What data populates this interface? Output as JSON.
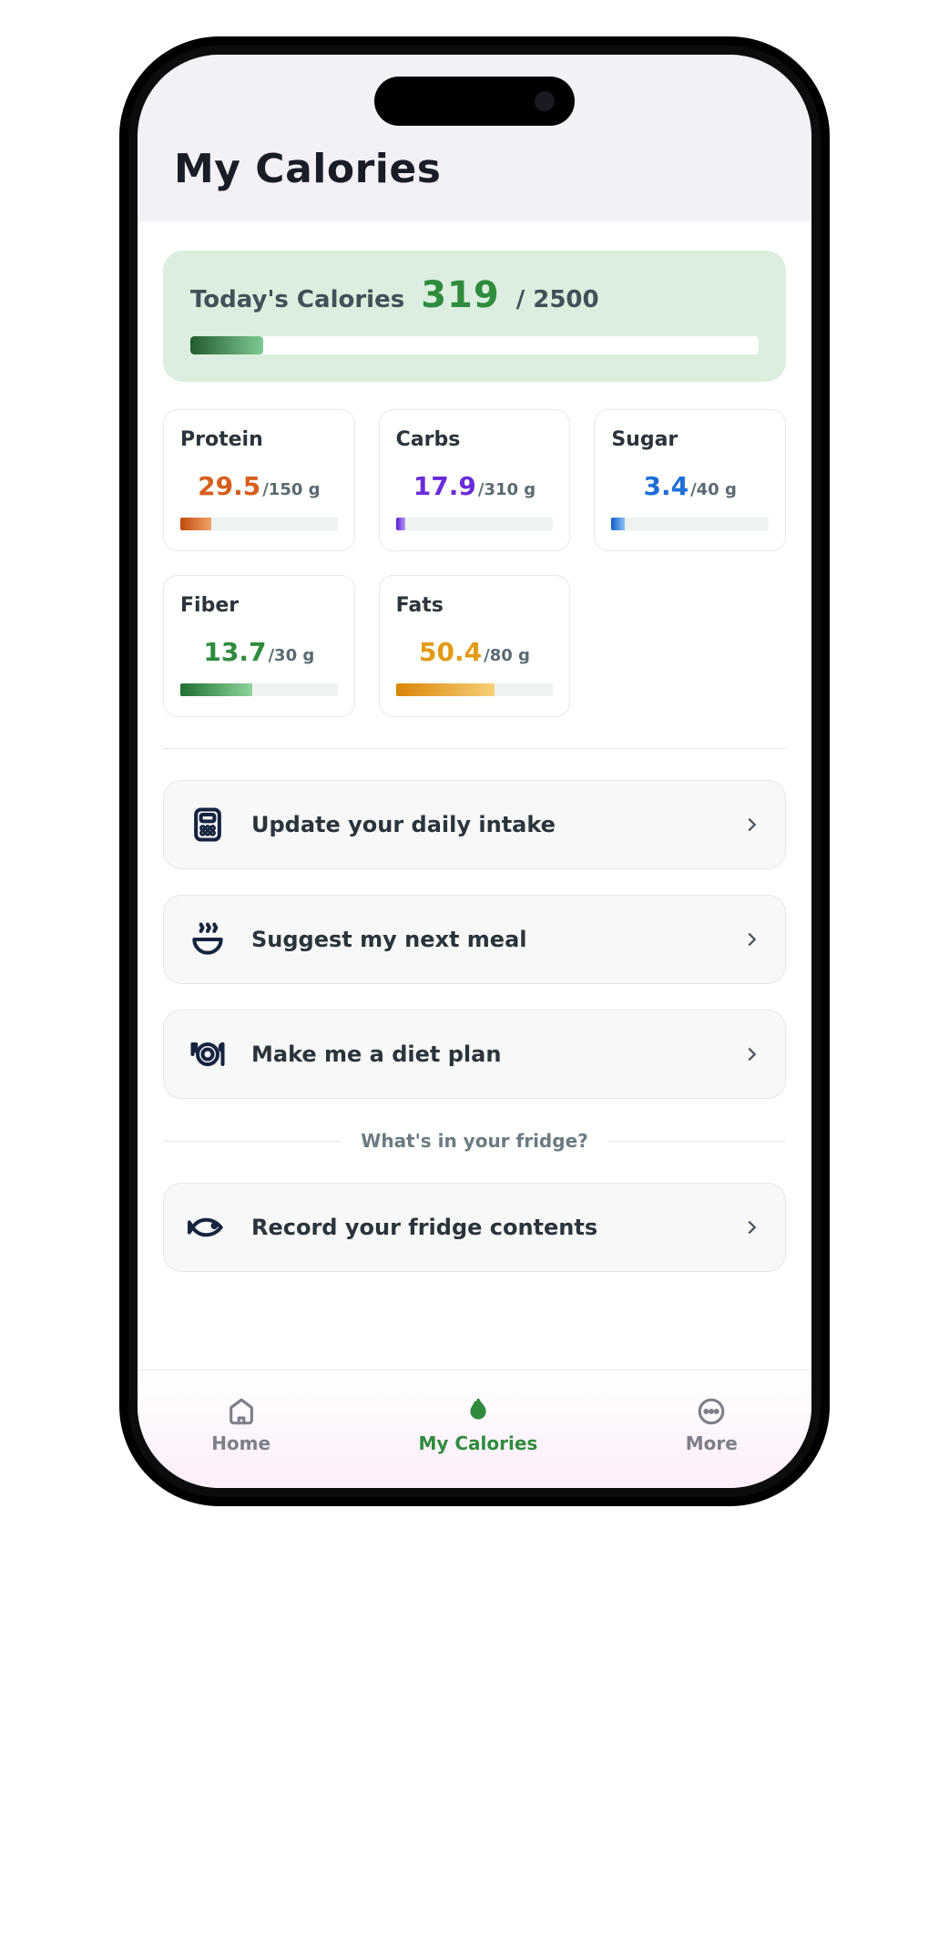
{
  "header": {
    "title": "My Calories"
  },
  "today": {
    "label": "Today's Calories",
    "value": "319",
    "sep": "/",
    "max": "2500",
    "pct": 12.76
  },
  "macros": [
    {
      "label": "Protein",
      "value": "29.5",
      "max": "/150 g",
      "pct": 19.7,
      "color": "orange"
    },
    {
      "label": "Carbs",
      "value": "17.9",
      "max": "/310 g",
      "pct": 5.8,
      "color": "purple"
    },
    {
      "label": "Sugar",
      "value": "3.4",
      "max": "/40 g",
      "pct": 8.5,
      "color": "blue"
    },
    {
      "label": "Fiber",
      "value": "13.7",
      "max": "/30 g",
      "pct": 45.7,
      "color": "green"
    },
    {
      "label": "Fats",
      "value": "50.4",
      "max": "/80 g",
      "pct": 63.0,
      "color": "amber"
    }
  ],
  "actions": [
    {
      "label": "Update your daily intake",
      "icon": "calculator"
    },
    {
      "label": "Suggest my next meal",
      "icon": "soup"
    },
    {
      "label": "Make me a diet plan",
      "icon": "plate"
    }
  ],
  "fridge": {
    "heading": "What's in your fridge?",
    "action": {
      "label": "Record your fridge contents",
      "icon": "fish"
    }
  },
  "tabs": [
    {
      "label": "Home",
      "icon": "home",
      "active": false
    },
    {
      "label": "My Calories",
      "icon": "flame",
      "active": true
    },
    {
      "label": "More",
      "icon": "more",
      "active": false
    }
  ]
}
